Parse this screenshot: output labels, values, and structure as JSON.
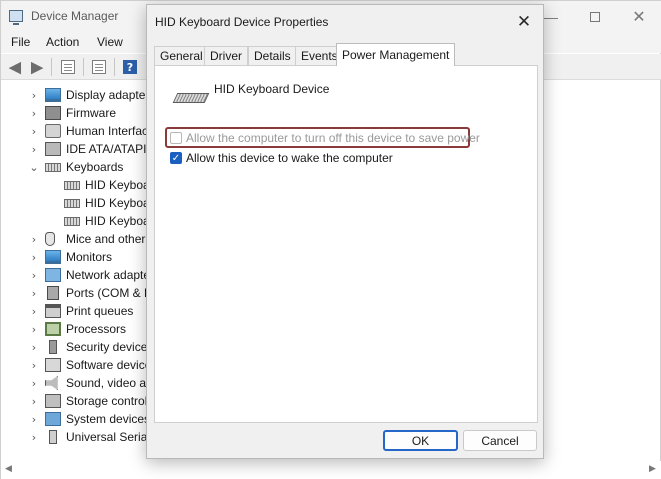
{
  "device_manager": {
    "title": "Device Manager",
    "menu": [
      "File",
      "Action",
      "View"
    ],
    "toolbar_icons": [
      "back-arrow-icon",
      "forward-arrow-icon",
      "properties-sheet-icon",
      "update-driver-icon",
      "help-icon"
    ],
    "tree": [
      {
        "label": "Display adapter",
        "icon": "monitor-icon",
        "expanded": false,
        "level": 0
      },
      {
        "label": "Firmware",
        "icon": "chip-icon",
        "expanded": false,
        "level": 0
      },
      {
        "label": "Human Interfac",
        "icon": "hid-icon",
        "expanded": false,
        "level": 0
      },
      {
        "label": "IDE ATA/ATAPI c",
        "icon": "disk-icon",
        "expanded": false,
        "level": 0
      },
      {
        "label": "Keyboards",
        "icon": "keyboard-icon",
        "expanded": true,
        "level": 0
      },
      {
        "label": "HID Keyboa",
        "icon": "keyboard-icon",
        "level": 1
      },
      {
        "label": "HID Keyboa",
        "icon": "keyboard-icon",
        "level": 1
      },
      {
        "label": "HID Keyboa",
        "icon": "keyboard-icon",
        "level": 1
      },
      {
        "label": "Mice and other",
        "icon": "mouse-icon",
        "expanded": false,
        "level": 0
      },
      {
        "label": "Monitors",
        "icon": "monitor-icon",
        "expanded": false,
        "level": 0
      },
      {
        "label": "Network adapte",
        "icon": "network-icon",
        "expanded": false,
        "level": 0
      },
      {
        "label": "Ports (COM & L",
        "icon": "port-icon",
        "expanded": false,
        "level": 0
      },
      {
        "label": "Print queues",
        "icon": "printer-icon",
        "expanded": false,
        "level": 0
      },
      {
        "label": "Processors",
        "icon": "processor-icon",
        "expanded": false,
        "level": 0
      },
      {
        "label": "Security device",
        "icon": "security-icon",
        "expanded": false,
        "level": 0
      },
      {
        "label": "Software device",
        "icon": "software-icon",
        "expanded": false,
        "level": 0
      },
      {
        "label": "Sound, video ar",
        "icon": "sound-icon",
        "expanded": false,
        "level": 0
      },
      {
        "label": "Storage control",
        "icon": "storage-icon",
        "expanded": false,
        "level": 0
      },
      {
        "label": "System devices",
        "icon": "system-icon",
        "expanded": false,
        "level": 0
      },
      {
        "label": "Universal Serial",
        "icon": "usb-icon",
        "expanded": false,
        "level": 0
      }
    ]
  },
  "dialog": {
    "title": "HID Keyboard Device Properties",
    "tabs": [
      {
        "label": "General",
        "active": false
      },
      {
        "label": "Driver",
        "active": false
      },
      {
        "label": "Details",
        "active": false
      },
      {
        "label": "Events",
        "active": false
      },
      {
        "label": "Power Management",
        "active": true
      }
    ],
    "device_name": "HID Keyboard Device",
    "options": [
      {
        "label": "Allow the computer to turn off this device to save power",
        "checked": false,
        "enabled": false,
        "highlighted": true
      },
      {
        "label": "Allow this device to wake the computer",
        "checked": true,
        "enabled": true
      }
    ],
    "buttons": {
      "ok": "OK",
      "cancel": "Cancel"
    }
  },
  "colors": {
    "accent": "#1b5fc0",
    "highlight_frame": "#8a3a3a",
    "dialog_bg": "#f0f0f0"
  }
}
